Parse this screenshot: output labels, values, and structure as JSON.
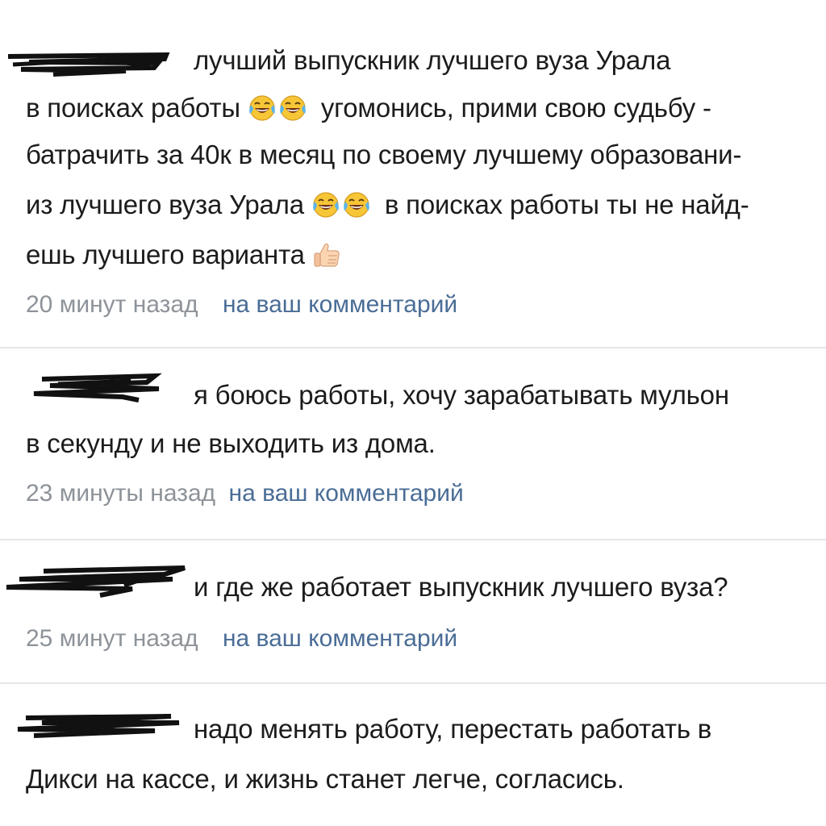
{
  "notifications": [
    {
      "lines": [
        "лучший выпускник лучшего вуза Урала",
        "в поисках работы",
        "угомонись, прими свою судьбу -",
        "батрачить за 40к в месяц по своему лучшему образовани-",
        "из лучшего вуза Урала",
        "в поисках работы ты не найд-",
        "ешь лучшего варианта"
      ],
      "time": "20 минут назад",
      "link": "на ваш комментарий"
    },
    {
      "lines": [
        "я боюсь работы, хочу зарабатывать мульон",
        "в секунду и не выходить из дома."
      ],
      "time": "23 минуты назад",
      "link": "на ваш комментарий"
    },
    {
      "lines": [
        "и где же работает выпускник лучшего вуза?"
      ],
      "time": "25 минут назад",
      "link": "на ваш комментарий"
    },
    {
      "lines": [
        "надо менять работу, перестать работать в",
        "Дикси на кассе, и жизнь станет легче, согласись."
      ]
    }
  ],
  "icons": {
    "laughing": "face-with-tears-of-joy-icon",
    "thumbs_up": "thumbs-up-icon"
  },
  "colors": {
    "text": "#1c1c1c",
    "time": "#8d9399",
    "link": "#4a6d96",
    "separator": "#e4e6e9",
    "redaction": "#111111"
  }
}
